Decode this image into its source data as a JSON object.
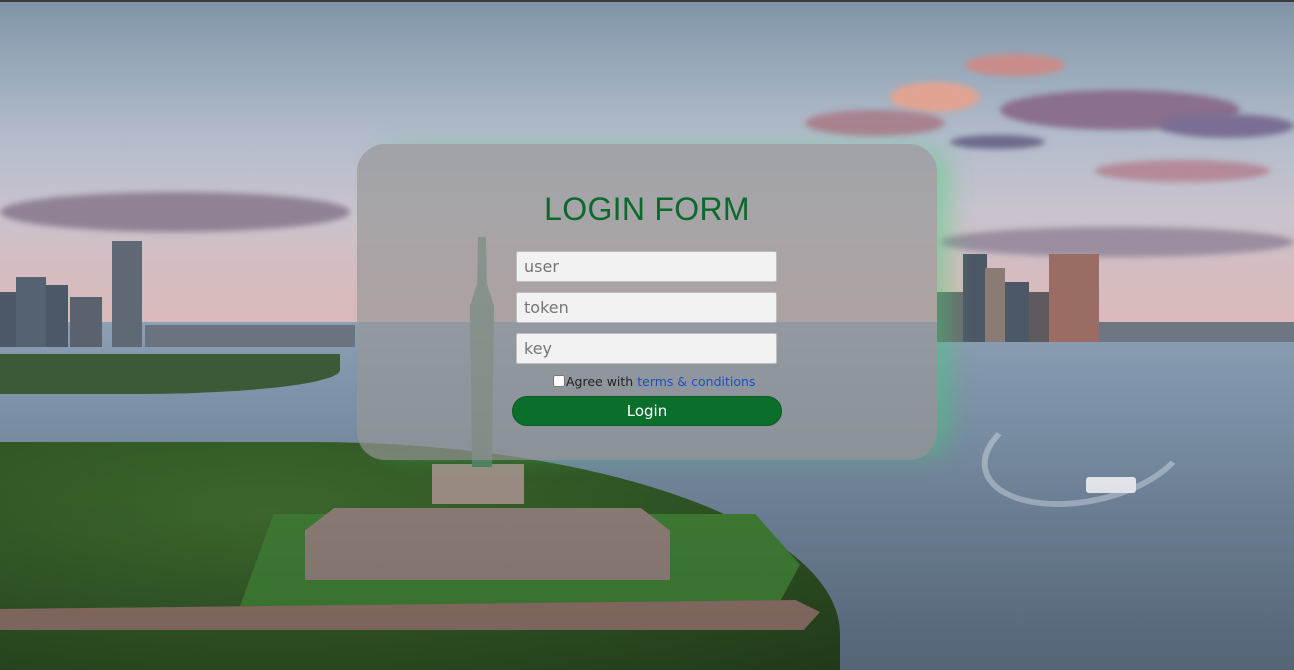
{
  "login_form": {
    "title": "LOGIN FORM",
    "fields": {
      "user": {
        "placeholder": "user",
        "value": ""
      },
      "token": {
        "placeholder": "token",
        "value": ""
      },
      "key": {
        "placeholder": "key",
        "value": ""
      }
    },
    "terms": {
      "checked": false,
      "prefix": "Agree with",
      "link_text": "terms & conditions"
    },
    "login_button": "Login"
  },
  "colors": {
    "title": "#0a6a2b",
    "button": "#0b6e2b",
    "link": "#1d4fc4",
    "panel_glow": "#3cd26e"
  }
}
